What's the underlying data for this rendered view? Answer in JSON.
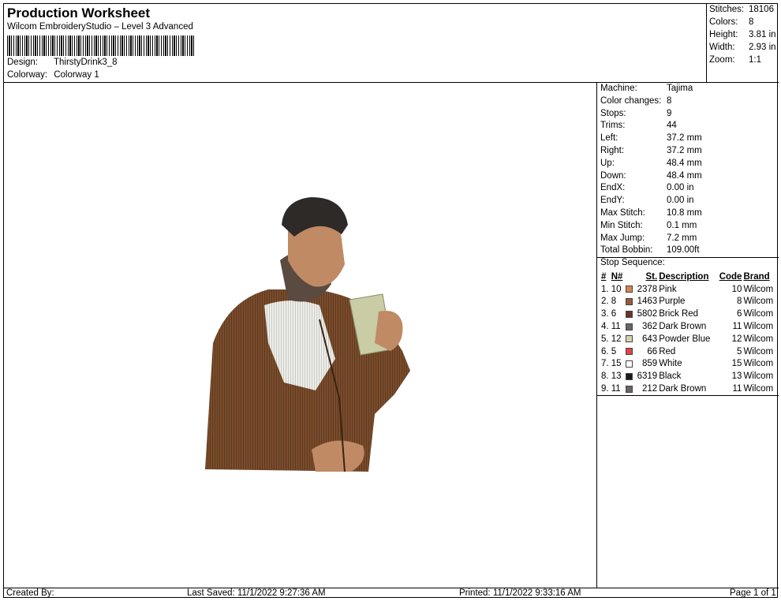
{
  "header": {
    "title": "Production Worksheet",
    "subtitle": "Wilcom EmbroideryStudio – Level 3 Advanced",
    "design_label": "Design:",
    "design_value": "ThirstyDrink3_8",
    "colorway_label": "Colorway:",
    "colorway_value": "Colorway 1"
  },
  "summary": {
    "stitches_label": "Stitches:",
    "stitches_value": "18106",
    "colors_label": "Colors:",
    "colors_value": "8",
    "height_label": "Height:",
    "height_value": "3.81 in",
    "width_label": "Width:",
    "width_value": "2.93 in",
    "zoom_label": "Zoom:",
    "zoom_value": "1:1"
  },
  "machine": [
    {
      "k": "Machine:",
      "v": "Tajima"
    },
    {
      "k": "Color changes:",
      "v": "8"
    },
    {
      "k": "Stops:",
      "v": "9"
    },
    {
      "k": "Trims:",
      "v": "44"
    },
    {
      "k": "Left:",
      "v": "37.2 mm"
    },
    {
      "k": "Right:",
      "v": "37.2 mm"
    },
    {
      "k": "Up:",
      "v": "48.4 mm"
    },
    {
      "k": "Down:",
      "v": "48.4 mm"
    },
    {
      "k": "EndX:",
      "v": "0.00 in"
    },
    {
      "k": "EndY:",
      "v": "0.00 in"
    },
    {
      "k": "Max Stitch:",
      "v": "10.8 mm"
    },
    {
      "k": "Min Stitch:",
      "v": "0.1 mm"
    },
    {
      "k": "Max Jump:",
      "v": "7.2 mm"
    },
    {
      "k": "Total Bobbin:",
      "v": "109.00ft"
    }
  ],
  "stop_sequence": {
    "label": "Stop Sequence:",
    "headers": {
      "num": "#",
      "n": "N#",
      "st": "St.",
      "desc": "Description",
      "code": "Code",
      "brand": "Brand"
    },
    "rows": [
      {
        "num": "1.",
        "n": "10",
        "color": "#d9834e",
        "st": "2378",
        "desc": "Pink",
        "code": "10",
        "brand": "Wilcom"
      },
      {
        "num": "2.",
        "n": "8",
        "color": "#9a5a3c",
        "st": "1463",
        "desc": "Purple",
        "code": "8",
        "brand": "Wilcom"
      },
      {
        "num": "3.",
        "n": "6",
        "color": "#6b3326",
        "st": "5802",
        "desc": "Brick Red",
        "code": "6",
        "brand": "Wilcom"
      },
      {
        "num": "4.",
        "n": "11",
        "color": "#6a6466",
        "st": "362",
        "desc": "Dark Brown",
        "code": "11",
        "brand": "Wilcom"
      },
      {
        "num": "5.",
        "n": "12",
        "color": "#d6d3b3",
        "st": "643",
        "desc": "Powder Blue",
        "code": "12",
        "brand": "Wilcom"
      },
      {
        "num": "6.",
        "n": "5",
        "color": "#e04545",
        "st": "66",
        "desc": "Red",
        "code": "5",
        "brand": "Wilcom"
      },
      {
        "num": "7.",
        "n": "15",
        "color": "#ffffff",
        "st": "859",
        "desc": "White",
        "code": "15",
        "brand": "Wilcom"
      },
      {
        "num": "8.",
        "n": "13",
        "color": "#1a1a1a",
        "st": "6319",
        "desc": "Black",
        "code": "13",
        "brand": "Wilcom"
      },
      {
        "num": "9.",
        "n": "11",
        "color": "#6a6466",
        "st": "212",
        "desc": "Dark Brown",
        "code": "11",
        "brand": "Wilcom"
      }
    ]
  },
  "footer": {
    "created_by": "Created By:",
    "last_saved": "Last Saved: 11/1/2022 9:27:36 AM",
    "printed": "Printed: 11/1/2022 9:33:16 AM",
    "page": "Page 1 of 1"
  }
}
